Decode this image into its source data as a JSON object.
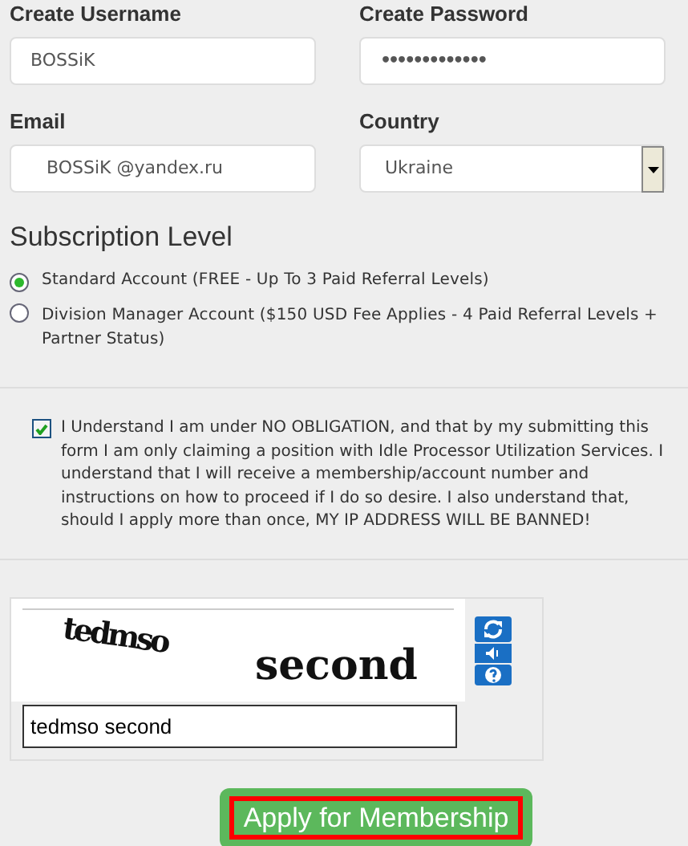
{
  "fields": [
    {
      "label": "Create Username",
      "kind": "text",
      "value": "BOSSiK"
    },
    {
      "label": "Create Password",
      "kind": "password",
      "value": "•••••••••••••"
    },
    {
      "label": "Email",
      "kind": "text",
      "value": "BOSSiK @yandex.ru"
    },
    {
      "label": "Country",
      "kind": "select",
      "value": "Ukraine"
    }
  ],
  "subscription": {
    "title": "Subscription Level",
    "options": [
      {
        "label": "Standard Account (FREE - Up To 3 Paid Referral Levels)",
        "selected": true
      },
      {
        "label": "Division Manager Account ($150 USD Fee Applies - 4 Paid Referral Levels + Partner Status)",
        "selected": false
      }
    ]
  },
  "agreement": {
    "checked": true,
    "text": "I Understand I am under NO OBLIGATION, and that by my submitting this form I am only claiming a position with Idle Processor Utilization Services. I understand that I will receive a membership/account number and instructions on how to proceed if I do so desire. I also understand that, should I apply more than once, MY IP ADDRESS WILL BE BANNED!"
  },
  "captcha": {
    "words": [
      "tedmso",
      "second"
    ],
    "response": "tedmso second"
  },
  "submit": {
    "label": "Apply for Membership"
  }
}
